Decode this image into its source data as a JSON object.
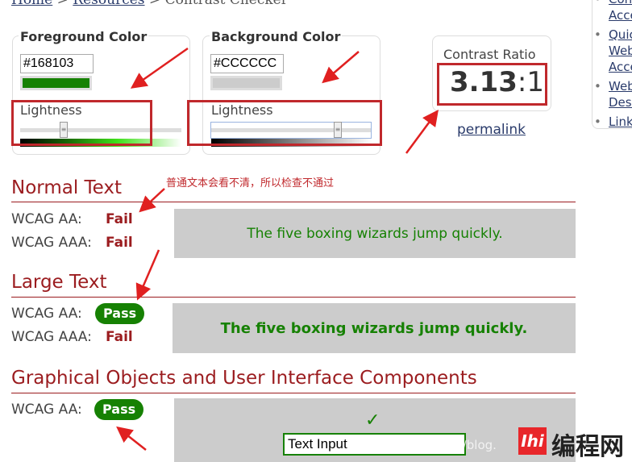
{
  "breadcrumb": {
    "home": "Home",
    "resources": "Resources",
    "current": "Contrast Checker",
    "sep": ">"
  },
  "foreground": {
    "title": "Foreground Color",
    "hex": "#168103",
    "color": "#168103",
    "lightness_label": "Lightness"
  },
  "background": {
    "title": "Background Color",
    "hex": "#CCCCCC",
    "color": "#CCCCCC",
    "lightness_label": "Lightness"
  },
  "ratio": {
    "title": "Contrast Ratio",
    "value": "3.13",
    "suffix": ":1",
    "permalink": "permalink"
  },
  "sidebar": {
    "items": [
      "Con\nAcce",
      "Quic\nWeb\nAcce",
      "Web\nDesi",
      "Link"
    ]
  },
  "annotation": {
    "note": "普通文本会看不清，所以检查不通过",
    "accent": "#c0282c"
  },
  "normal": {
    "title": "Normal Text",
    "aa_label": "WCAG AA:",
    "aa_result": "Fail",
    "aaa_label": "WCAG AAA:",
    "aaa_result": "Fail",
    "sample": "The five boxing wizards jump quickly."
  },
  "large": {
    "title": "Large Text",
    "aa_label": "WCAG AA:",
    "aa_result": "Pass",
    "aaa_label": "WCAG AAA:",
    "aaa_result": "Fail",
    "sample": "The five boxing wizards jump quickly."
  },
  "graphical": {
    "title": "Graphical Objects and User Interface Components",
    "aa_label": "WCAG AA:",
    "aa_result": "Pass",
    "check": "✓",
    "input_value": "Text Input"
  },
  "watermark": {
    "url": "https://blog.",
    "brand": "编程网",
    "logo": "lhi"
  }
}
